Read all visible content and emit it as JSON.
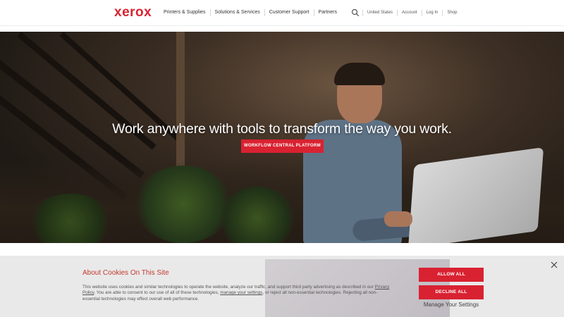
{
  "header": {
    "logo": "xerox",
    "nav": [
      "Printers & Supplies",
      "Solutions & Services",
      "Customer Support",
      "Partners"
    ],
    "utility": [
      "United States",
      "Account",
      "Log In",
      "Shop"
    ]
  },
  "hero": {
    "title": "Work anywhere with tools to transform the way you work.",
    "button": "WORKFLOW CENTRAL PLATFORM"
  },
  "cookie": {
    "title": "About Cookies On This Site",
    "text_1": "This website uses cookies and similar technologies to operate the website, analyze our traffic, and support third party advertising as described in our ",
    "privacy_link": "Privacy Policy",
    "text_2": ". You are able to consent to our use of all of these technologies, ",
    "settings_link": "manage your settings",
    "text_3": ", or reject all non-essential technologies. Rejecting all non-essential technologies may effect overall web performance.",
    "allow": "ALLOW ALL",
    "decline": "DECLINE ALL",
    "manage": "Manage Your Settings"
  },
  "colors": {
    "brand": "#d92231",
    "cookie_title": "#c23a2e",
    "cookie_bg": "#e9e9e9"
  }
}
